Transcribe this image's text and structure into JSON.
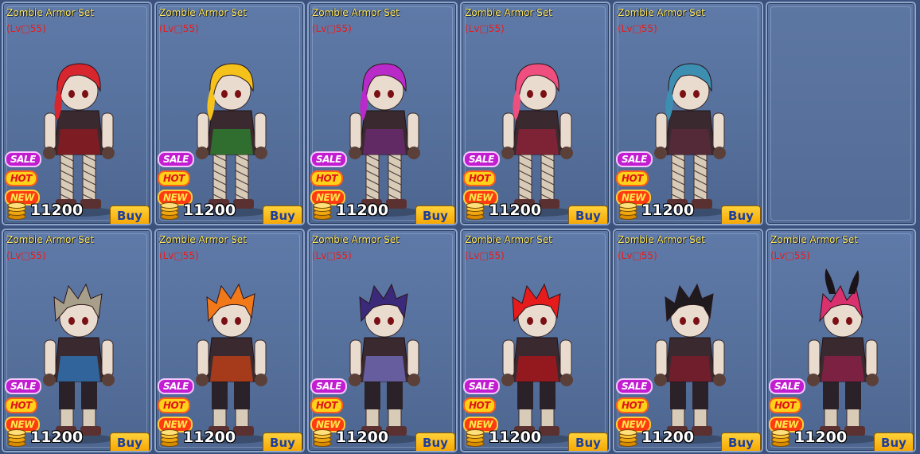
{
  "items": [
    {
      "name": "Zombie Armor Set",
      "level": "(Lv□55)",
      "price": "11200",
      "buy_label": "Buy",
      "badges": [
        "SALE",
        "HOT",
        "NEW"
      ],
      "hair_color": "#d8262e",
      "accent": "#8b1a22",
      "style": "female"
    },
    {
      "name": "Zombie Armor Set",
      "level": "(Lv□55)",
      "price": "11200",
      "buy_label": "Buy",
      "badges": [
        "SALE",
        "HOT",
        "NEW"
      ],
      "hair_color": "#f4c21a",
      "accent": "#2f7a2f",
      "style": "female"
    },
    {
      "name": "Zombie Armor Set",
      "level": "(Lv□55)",
      "price": "11200",
      "buy_label": "Buy",
      "badges": [
        "SALE",
        "HOT",
        "NEW"
      ],
      "hair_color": "#b82bc8",
      "accent": "#6a2a6e",
      "style": "female"
    },
    {
      "name": "Zombie Armor Set",
      "level": "(Lv□55)",
      "price": "11200",
      "buy_label": "Buy",
      "badges": [
        "SALE",
        "HOT",
        "NEW"
      ],
      "hair_color": "#ee4f7e",
      "accent": "#8b2236",
      "style": "female"
    },
    {
      "name": "Zombie Armor Set",
      "level": "(Lv□55)",
      "price": "11200",
      "buy_label": "Buy",
      "badges": [
        "SALE",
        "HOT",
        "NEW"
      ],
      "hair_color": "#3d8fb2",
      "accent": "#5a2a3a",
      "style": "female"
    },
    {
      "empty": true
    },
    {
      "name": "Zombie Armor Set",
      "level": "(Lv□55)",
      "price": "11200",
      "buy_label": "Buy",
      "badges": [
        "SALE",
        "HOT",
        "NEW"
      ],
      "hair_color": "#a89f8a",
      "accent": "#2f6fae",
      "style": "male"
    },
    {
      "name": "Zombie Armor Set",
      "level": "(Lv□55)",
      "price": "11200",
      "buy_label": "Buy",
      "badges": [
        "SALE",
        "HOT",
        "NEW"
      ],
      "hair_color": "#f2791a",
      "accent": "#b93e17",
      "style": "male"
    },
    {
      "name": "Zombie Armor Set",
      "level": "(Lv□55)",
      "price": "11200",
      "buy_label": "Buy",
      "badges": [
        "SALE",
        "HOT",
        "NEW"
      ],
      "hair_color": "#3b2a7a",
      "accent": "#6d66b0",
      "style": "male"
    },
    {
      "name": "Zombie Armor Set",
      "level": "(Lv□55)",
      "price": "11200",
      "buy_label": "Buy",
      "badges": [
        "SALE",
        "HOT",
        "NEW"
      ],
      "hair_color": "#e61c1c",
      "accent": "#a3161c",
      "style": "male"
    },
    {
      "name": "Zombie Armor Set",
      "level": "(Lv□55)",
      "price": "11200",
      "buy_label": "Buy",
      "badges": [
        "SALE",
        "HOT",
        "NEW"
      ],
      "hair_color": "#1e1a1e",
      "accent": "#7a1c2a",
      "style": "male"
    },
    {
      "name": "Zombie Armor Set",
      "level": "(Lv□55)",
      "price": "11200",
      "buy_label": "Buy",
      "badges": [
        "SALE",
        "HOT",
        "NEW"
      ],
      "hair_color": "#d9306e",
      "accent": "#8a2045",
      "style": "horned"
    }
  ],
  "icons": {
    "coin": "coin-stack-icon",
    "badge_sale": "sale-badge-icon",
    "badge_hot": "hot-badge-icon",
    "badge_new": "new-badge-icon"
  }
}
